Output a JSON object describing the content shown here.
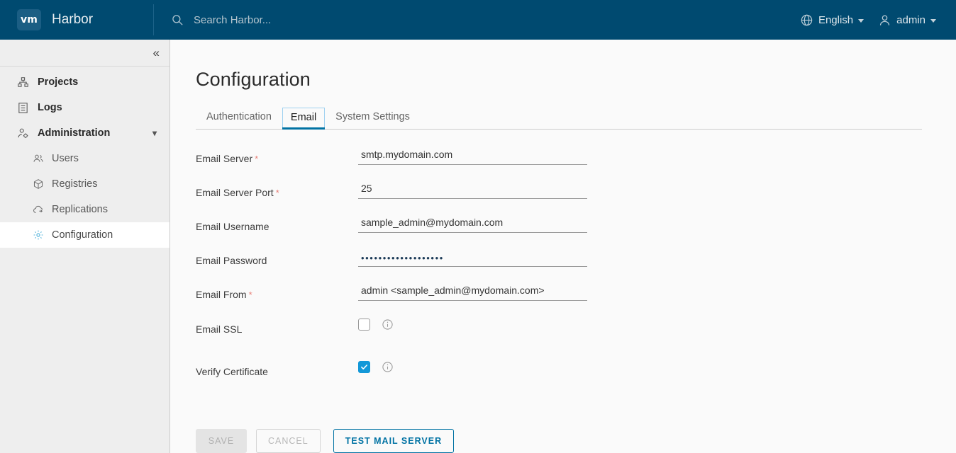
{
  "header": {
    "logo_text": "vm",
    "brand": "Harbor",
    "search_placeholder": "Search Harbor...",
    "search_value": "",
    "language": "English",
    "user": "admin",
    "accent": "#004a70"
  },
  "sidebar": {
    "collapse_glyph": "«",
    "items": [
      {
        "label": "Projects",
        "icon": "projects-icon",
        "level": "top",
        "active": false
      },
      {
        "label": "Logs",
        "icon": "logs-icon",
        "level": "top",
        "active": false
      },
      {
        "label": "Administration",
        "icon": "administration-icon",
        "level": "top",
        "active": false,
        "expanded": true
      },
      {
        "label": "Users",
        "icon": "users-icon",
        "level": "sub",
        "active": false
      },
      {
        "label": "Registries",
        "icon": "registries-icon",
        "level": "sub",
        "active": false
      },
      {
        "label": "Replications",
        "icon": "replications-icon",
        "level": "sub",
        "active": false
      },
      {
        "label": "Configuration",
        "icon": "configuration-gear-icon",
        "level": "sub",
        "active": true
      }
    ]
  },
  "main": {
    "page_title": "Configuration",
    "tabs": [
      {
        "label": "Authentication",
        "active": false
      },
      {
        "label": "Email",
        "active": true
      },
      {
        "label": "System Settings",
        "active": false
      }
    ],
    "active_tab": "Email",
    "form": {
      "email_server": {
        "label": "Email Server",
        "required": true,
        "value": "smtp.mydomain.com"
      },
      "email_server_port": {
        "label": "Email Server Port",
        "required": true,
        "value": "25"
      },
      "email_username": {
        "label": "Email Username",
        "required": false,
        "value": "sample_admin@mydomain.com"
      },
      "email_password": {
        "label": "Email Password",
        "required": false,
        "value": "•••••••••••••••••••"
      },
      "email_from": {
        "label": "Email From",
        "required": true,
        "value": "admin <sample_admin@mydomain.com>"
      },
      "email_ssl": {
        "label": "Email SSL",
        "checked": false
      },
      "verify_certificate": {
        "label": "Verify Certificate",
        "checked": true
      }
    },
    "buttons": {
      "save": {
        "label": "Save",
        "disabled": true
      },
      "cancel": {
        "label": "Cancel",
        "disabled": true
      },
      "test": {
        "label": "Test Mail Server",
        "disabled": false
      }
    }
  },
  "colors": {
    "header_bg": "#004a70",
    "sidebar_bg": "#eeeeee",
    "content_bg": "#fafafa",
    "link_blue": "#0072a3",
    "checkbox_blue": "#1398d8",
    "required_red": "#e8837b"
  }
}
